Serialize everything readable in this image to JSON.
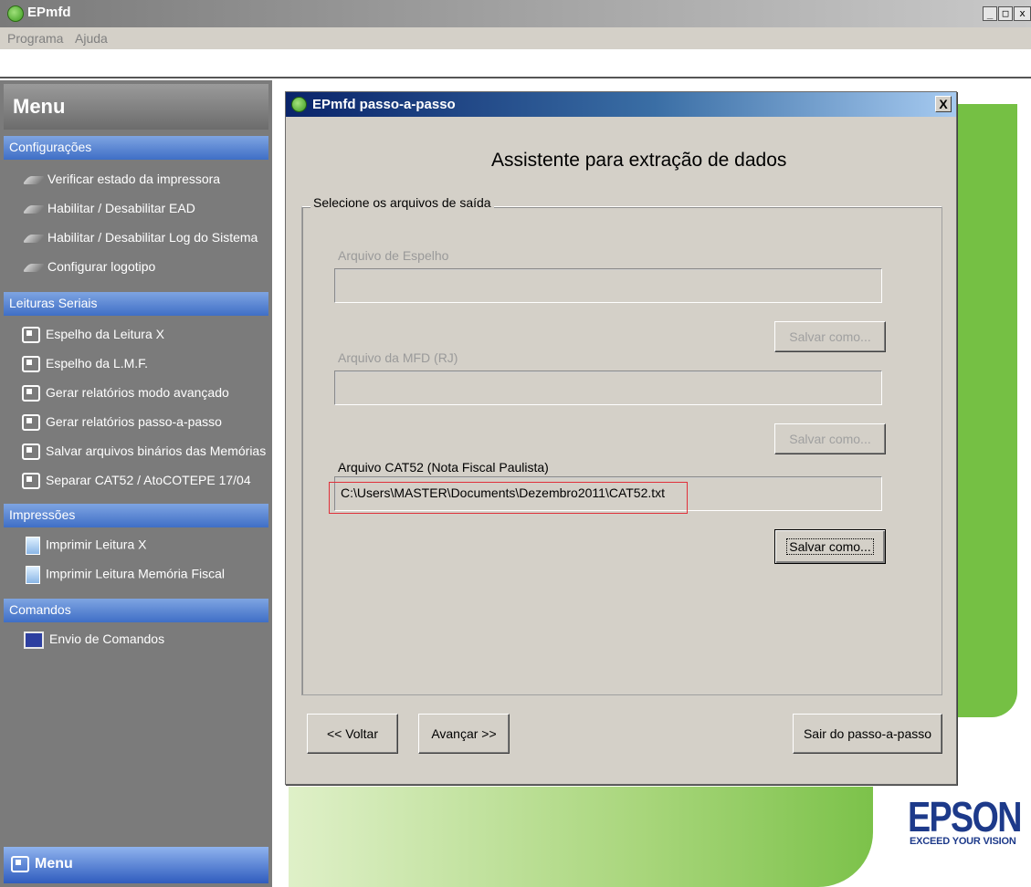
{
  "window": {
    "title": "EPmfd",
    "controls": [
      "_",
      "□",
      "x"
    ]
  },
  "menubar": {
    "items": [
      "Programa",
      "Ajuda"
    ]
  },
  "sidebar": {
    "header": "Menu",
    "sections": [
      {
        "title": "Configurações",
        "items": [
          "Verificar estado da impressora",
          "Habilitar / Desabilitar EAD",
          "Habilitar / Desabilitar Log do Sistema",
          "Configurar logotipo"
        ]
      },
      {
        "title": "Leituras Seriais",
        "items": [
          "Espelho da Leitura X",
          "Espelho da L.M.F.",
          "Gerar relatórios modo avançado",
          "Gerar relatórios passo-a-passo",
          "Salvar arquivos binários das Memórias",
          "Separar CAT52 / AtoCOTEPE 17/04"
        ]
      },
      {
        "title": "Impressões",
        "items": [
          "Imprimir Leitura X",
          "Imprimir Leitura Memória Fiscal"
        ]
      },
      {
        "title": "Comandos",
        "items": [
          "Envio de Comandos"
        ]
      }
    ],
    "footer": "Menu"
  },
  "dialog": {
    "title": "EPmfd passo-a-passo",
    "close": "X",
    "heading": "Assistente para extração de dados",
    "group_label": "Selecione os arquivos de saída",
    "fields": [
      {
        "label": "Arquivo de Espelho",
        "value": "",
        "button": "Salvar como...",
        "enabled": false
      },
      {
        "label": "Arquivo da MFD (RJ)",
        "value": "",
        "button": "Salvar como...",
        "enabled": false
      },
      {
        "label": "Arquivo CAT52 (Nota Fiscal Paulista)",
        "value": "C:\\Users\\MASTER\\Documents\\Dezembro2011\\CAT52.txt",
        "button": "Salvar como...",
        "enabled": true
      }
    ],
    "buttons": {
      "back": "<< Voltar",
      "next": "Avançar >>",
      "exit": "Sair do passo-a-passo"
    }
  },
  "brand": {
    "logo": "EPSON",
    "tagline": "EXCEED YOUR VISION"
  }
}
